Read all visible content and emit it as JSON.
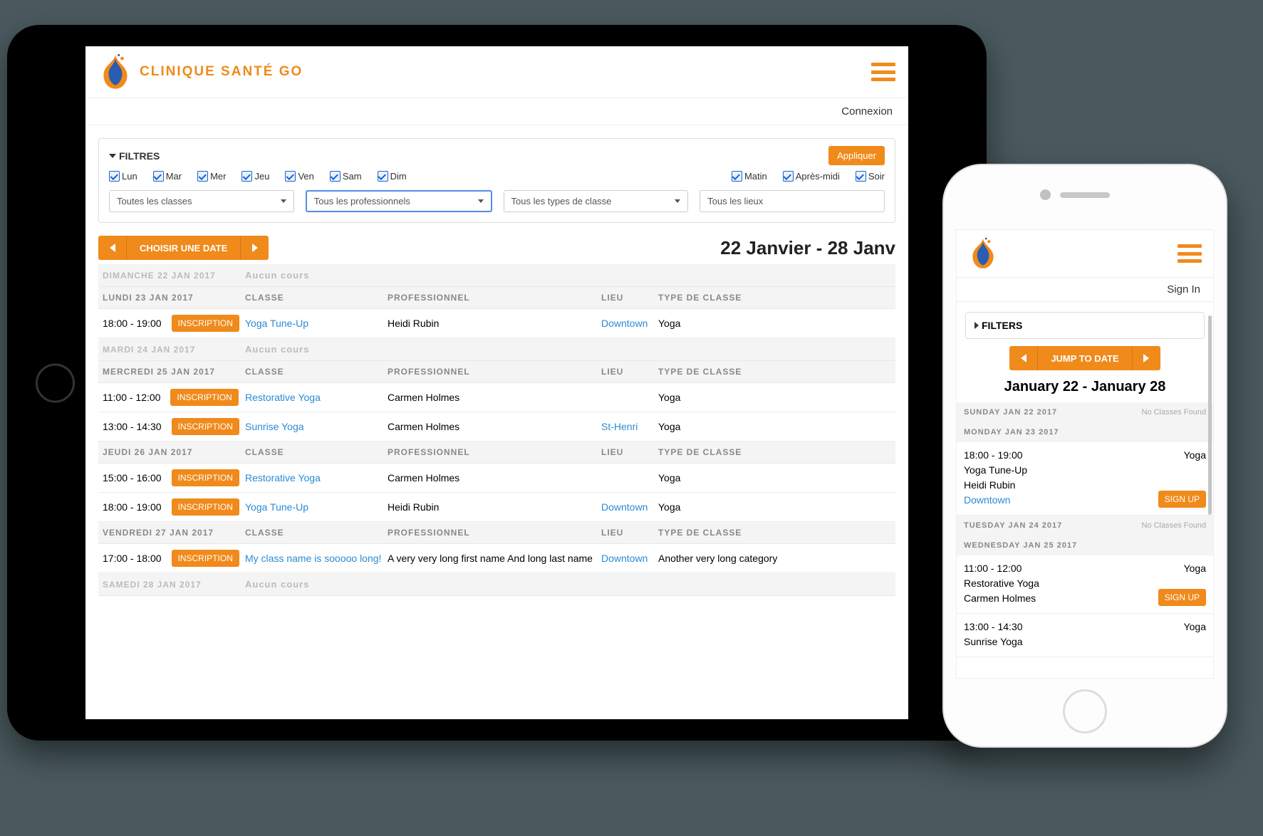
{
  "tablet": {
    "logo_text": "CLINIQUE SANTÉ GO",
    "login": "Connexion",
    "filters_label": "FILTRES",
    "apply_label": "Appliquer",
    "days": [
      "Lun",
      "Mar",
      "Mer",
      "Jeu",
      "Ven",
      "Sam",
      "Dim"
    ],
    "times": [
      "Matin",
      "Après-midi",
      "Soir"
    ],
    "selects": {
      "classes": "Toutes les classes",
      "pros": "Tous les professionnels",
      "types": "Tous les types de classe",
      "places": "Tous les lieux"
    },
    "choose_date": "CHOISIR UNE DATE",
    "daterange": "22 Janvier - 28 Janv",
    "col": {
      "class": "CLASSE",
      "pro": "PROFESSIONNEL",
      "lieu": "LIEU",
      "type": "TYPE DE CLASSE"
    },
    "inscription": "INSCRIPTION",
    "no_class": "Aucun cours",
    "schedule": [
      {
        "kind": "empty",
        "day": "DIMANCHE 22 JAN 2017"
      },
      {
        "kind": "header",
        "day": "LUNDI 23 JAN 2017"
      },
      {
        "kind": "row",
        "time": "18:00 - 19:00",
        "class": "Yoga Tune-Up",
        "pro": "Heidi Rubin",
        "lieu": "Downtown",
        "type": "Yoga"
      },
      {
        "kind": "empty",
        "day": "MARDI 24 JAN 2017"
      },
      {
        "kind": "header",
        "day": "MERCREDI 25 JAN 2017"
      },
      {
        "kind": "row",
        "time": "11:00 - 12:00",
        "class": "Restorative Yoga",
        "pro": "Carmen Holmes",
        "lieu": "",
        "type": "Yoga"
      },
      {
        "kind": "row",
        "time": "13:00 - 14:30",
        "class": "Sunrise Yoga",
        "pro": "Carmen Holmes",
        "lieu": "St-Henri",
        "type": "Yoga"
      },
      {
        "kind": "header",
        "day": "JEUDI 26 JAN 2017"
      },
      {
        "kind": "row",
        "time": "15:00 - 16:00",
        "class": "Restorative Yoga",
        "pro": "Carmen Holmes",
        "lieu": "",
        "type": "Yoga"
      },
      {
        "kind": "row",
        "time": "18:00 - 19:00",
        "class": "Yoga Tune-Up",
        "pro": "Heidi Rubin",
        "lieu": "Downtown",
        "type": "Yoga"
      },
      {
        "kind": "header",
        "day": "VENDREDI 27 JAN 2017"
      },
      {
        "kind": "row",
        "time": "17:00 - 18:00",
        "class": "My class name is sooooo long!",
        "pro": "A very very long first name And long last name",
        "lieu": "Downtown",
        "type": "Another very long category"
      },
      {
        "kind": "empty",
        "day": "SAMEDI 28 JAN 2017"
      }
    ]
  },
  "phone": {
    "login": "Sign In",
    "filters_label": "FILTERS",
    "jump_label": "JUMP TO DATE",
    "daterange": "January 22 - January 28",
    "no_class": "No Classes Found",
    "signup": "SIGN UP",
    "schedule": [
      {
        "kind": "empty",
        "day": "SUNDAY JAN 22 2017"
      },
      {
        "kind": "header",
        "day": "MONDAY JAN 23 2017"
      },
      {
        "kind": "row",
        "time": "18:00 - 19:00",
        "class": "Yoga Tune-Up",
        "pro": "Heidi Rubin",
        "lieu": "Downtown",
        "type": "Yoga",
        "signup": true
      },
      {
        "kind": "empty",
        "day": "TUESDAY JAN 24 2017"
      },
      {
        "kind": "header",
        "day": "WEDNESDAY JAN 25 2017"
      },
      {
        "kind": "row",
        "time": "11:00 - 12:00",
        "class": "Restorative Yoga",
        "pro": "Carmen Holmes",
        "lieu": "",
        "type": "Yoga",
        "signup": true
      },
      {
        "kind": "row",
        "time": "13:00 - 14:30",
        "class": "Sunrise Yoga",
        "pro": "",
        "lieu": "",
        "type": "Yoga",
        "signup": false
      }
    ]
  }
}
